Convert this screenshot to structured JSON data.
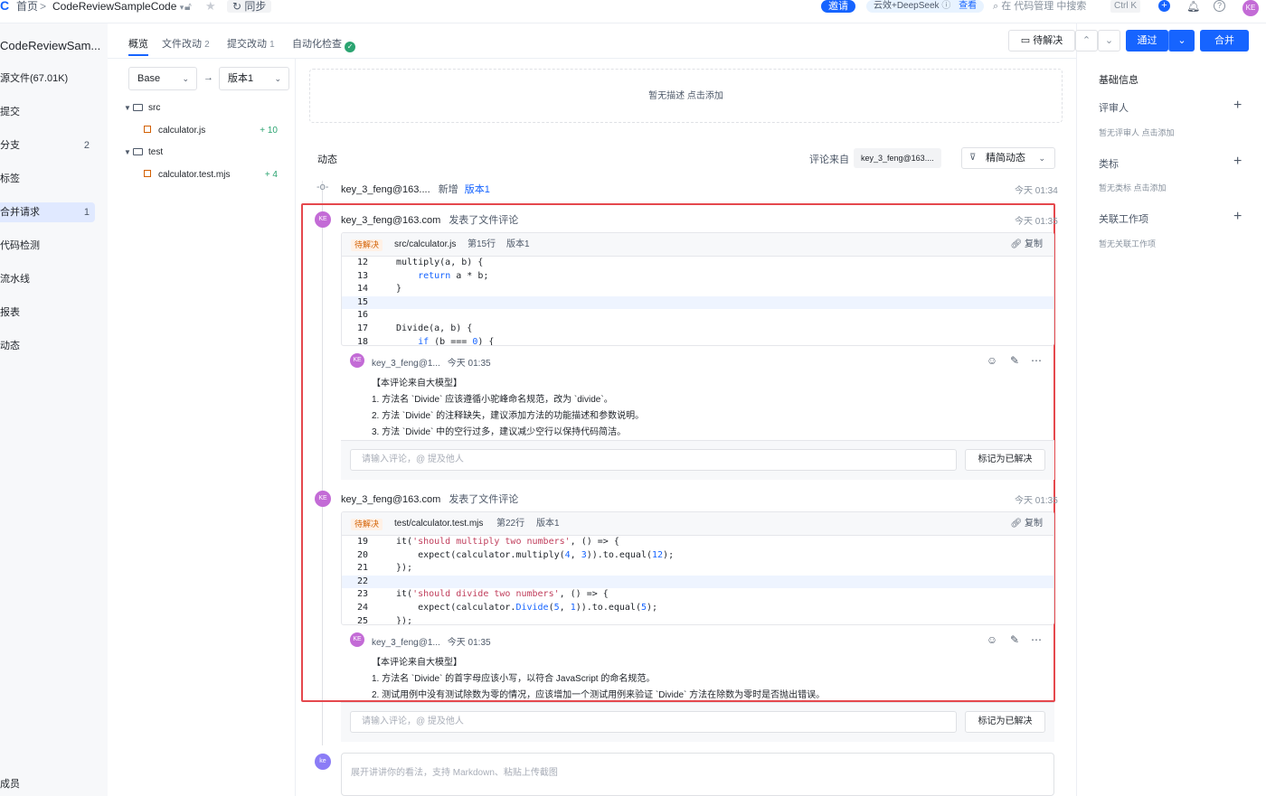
{
  "topbar": {
    "breadcrumb_home": "首页",
    "breadcrumb_sep": ">",
    "repo_name": "CodeReviewSampleCode",
    "sync_label": "同步",
    "invite_label": "邀请",
    "ai_pill": "云效+DeepSeek",
    "ai_pill_link": "查看",
    "search_placeholder": "在 代码管理 中搜索",
    "shortcut": "Ctrl K",
    "avatar": "KE"
  },
  "sidebar": {
    "repo_title": "CodeReviewSam...",
    "items": [
      {
        "label": "源文件(67.01K)",
        "count": ""
      },
      {
        "label": "提交",
        "count": ""
      },
      {
        "label": "分支",
        "count": "2"
      },
      {
        "label": "标签",
        "count": ""
      },
      {
        "label": "合并请求",
        "count": "1"
      },
      {
        "label": "代码检测",
        "count": ""
      },
      {
        "label": "流水线",
        "count": ""
      },
      {
        "label": "报表",
        "count": ""
      },
      {
        "label": "动态",
        "count": ""
      }
    ],
    "bottom_item": "成员"
  },
  "tabs": {
    "overview": "概览",
    "files": "文件改动",
    "files_count": "2",
    "commits": "提交改动",
    "commits_count": "1",
    "checks": "自动化检查"
  },
  "filetree": {
    "base": "Base",
    "arrow": "→",
    "version": "版本1",
    "folders": [
      {
        "name": "src",
        "file": "calculator.js",
        "additions": "+ 10"
      },
      {
        "name": "test",
        "file": "calculator.test.mjs",
        "additions": "+ 4"
      }
    ]
  },
  "description_placeholder": "暂无描述 点击添加",
  "activity": {
    "title": "动态",
    "filter_label": "评论来自",
    "filter_chip": "key_3_feng@163....",
    "filter_select": "精简动态",
    "event1": {
      "user": "key_3_feng@163....",
      "action": "新增",
      "link": "版本1",
      "time": "今天 01:34"
    }
  },
  "threads": [
    {
      "user": "key_3_feng@163.com",
      "action": "发表了文件评论",
      "time": "今天 01:35",
      "status": "待解决",
      "file": "src/calculator.js",
      "line": "第15行",
      "version": "版本1",
      "copy": "复制",
      "code": [
        {
          "ln": "12",
          "src": "multiply(a, b) {"
        },
        {
          "ln": "13",
          "src": "    return a * b;"
        },
        {
          "ln": "14",
          "src": "}"
        },
        {
          "ln": "15",
          "src": ""
        },
        {
          "ln": "16",
          "src": ""
        },
        {
          "ln": "17",
          "src": "Divide(a, b) {"
        },
        {
          "ln": "18",
          "src": "    if (b === 0) {"
        }
      ],
      "comment_user": "key_3_feng@1...",
      "comment_time": "今天 01:35",
      "comment_lines": [
        "【本评论来自大模型】",
        "1. 方法名 `Divide` 应该遵循小驼峰命名规范，改为 `divide`。",
        "2. 方法 `Divide` 的注释缺失，建议添加方法的功能描述和参数说明。",
        "3. 方法 `Divide` 中的空行过多，建议减少空行以保持代码简洁。"
      ],
      "reply_placeholder": "请输入评论，@ 提及他人",
      "resolve": "标记为已解决"
    },
    {
      "user": "key_3_feng@163.com",
      "action": "发表了文件评论",
      "time": "今天 01:35",
      "status": "待解决",
      "file": "test/calculator.test.mjs",
      "line": "第22行",
      "version": "版本1",
      "copy": "复制",
      "code": [
        {
          "ln": "19",
          "src": "it('should multiply two numbers', () => {"
        },
        {
          "ln": "20",
          "src": "    expect(calculator.multiply(4, 3)).to.equal(12);"
        },
        {
          "ln": "21",
          "src": "});"
        },
        {
          "ln": "22",
          "src": ""
        },
        {
          "ln": "23",
          "src": "it('should divide two numbers', () => {"
        },
        {
          "ln": "24",
          "src": "    expect(calculator.Divide(5, 1)).to.equal(5);"
        },
        {
          "ln": "25",
          "src": "});"
        }
      ],
      "comment_user": "key_3_feng@1...",
      "comment_time": "今天 01:35",
      "comment_lines": [
        "【本评论来自大模型】",
        "1. 方法名 `Divide` 的首字母应该小写，以符合 JavaScript 的命名规范。",
        "2. 测试用例中没有测试除数为零的情况，应该增加一个测试用例来验证 `Divide` 方法在除数为零时是否抛出错误。"
      ],
      "reply_placeholder": "请输入评论，@ 提及他人",
      "resolve": "标记为已解决"
    }
  ],
  "bottom_comment_placeholder": "展开讲讲你的看法，支持 Markdown、粘贴上传截图",
  "bottom_avatar": "ke",
  "right": {
    "pending_btn": "待解决",
    "approve_btn": "通过",
    "merge_btn": "合并",
    "section_basic": "基础信息",
    "reviewers": "评审人",
    "reviewers_hint": "暂无评审人 点击添加",
    "labels": "类标",
    "labels_hint": "暂无类标 点击添加",
    "workitems": "关联工作项",
    "workitems_hint": "暂无关联工作项"
  }
}
